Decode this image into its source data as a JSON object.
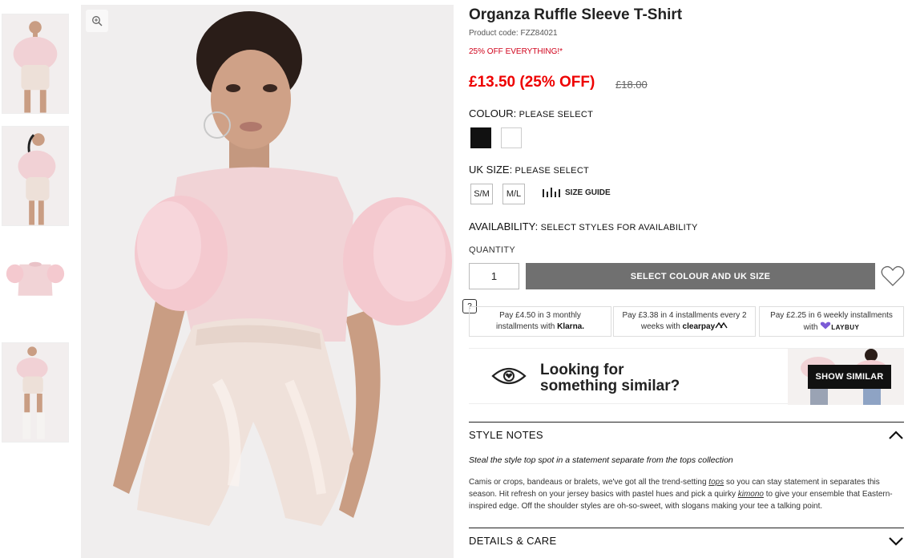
{
  "product": {
    "title": "Organza Ruffle Sleeve T-Shirt",
    "code": "Product code: FZZ84021",
    "promo": "25% OFF EVERYTHING!*",
    "price": "£13.50 (25% OFF)",
    "old_price": "£18.00"
  },
  "colour": {
    "label": "COLOUR:",
    "value": "PLEASE SELECT",
    "swatches": [
      "#111111",
      "#ffffff"
    ]
  },
  "size": {
    "label": "UK SIZE:",
    "value": "PLEASE SELECT",
    "options": [
      "S/M",
      "M/L"
    ],
    "guide": "SIZE GUIDE"
  },
  "availability": {
    "label": "AVAILABILITY:",
    "value": "SELECT STYLES FOR AVAILABILITY"
  },
  "quantity": {
    "label": "QUANTITY",
    "value": "1"
  },
  "cta": "SELECT COLOUR AND UK SIZE",
  "payments": {
    "help": "?",
    "klarna": {
      "line1_a": "Pay ",
      "line1_b": "£4.50",
      "line1_c": " in 3 monthly",
      "line2": "installments with ",
      "brand": "Klarna."
    },
    "clearpay": {
      "line1_a": "Pay ",
      "line1_b": "£3.38",
      "line1_c": " in 4 installments every 2",
      "line2": "weeks with ",
      "brand": "clearpay"
    },
    "laybuy": {
      "line1_a": "Pay ",
      "line1_b": "£2.25",
      "line1_c": " in 6 weekly installments",
      "line2": "with ",
      "brand": "LAYBUY"
    }
  },
  "similar": {
    "line1": "Looking for",
    "line2": "something similar?",
    "button": "SHOW SIMILAR"
  },
  "style_notes": {
    "heading": "STYLE NOTES",
    "lead": "Steal the style top spot in a statement separate from the tops collection",
    "desc_1": "Camis or crops, bandeaus or bralets, we've got all the trend-setting ",
    "link_tops": "tops",
    "desc_2": " so you can stay statement in separates this season. Hit refresh on your jersey basics with pastel hues and pick a quirky ",
    "link_kimono": "kimono",
    "desc_3": " to give your ensemble that Eastern-inspired edge. Off the shoulder styles are oh-so-sweet, with slogans making your tee a talking point."
  },
  "details": {
    "heading": "DETAILS & CARE"
  },
  "colors": {
    "sale_red": "#e00000",
    "cta_grey": "#707070",
    "top_pink": "#f1d3d6",
    "shorts_satin": "#efe1da"
  }
}
